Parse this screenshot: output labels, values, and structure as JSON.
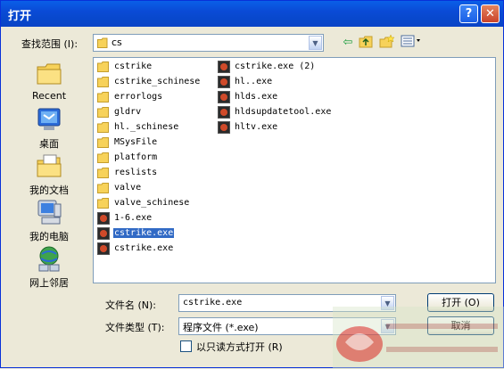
{
  "window": {
    "title": "打开",
    "help_glyph": "?",
    "close_glyph": "✕"
  },
  "lookin": {
    "label": "查找范围 (I):",
    "value": "cs"
  },
  "toolbar": {
    "icons": [
      "back-icon",
      "up-folder-icon",
      "new-folder-icon",
      "view-menu-icon"
    ]
  },
  "places": [
    {
      "label": "Recent",
      "icon": "recent-icon"
    },
    {
      "label": "桌面",
      "icon": "desktop-icon"
    },
    {
      "label": "我的文档",
      "icon": "my-documents-icon"
    },
    {
      "label": "我的电脑",
      "icon": "my-computer-icon"
    },
    {
      "label": "网上邻居",
      "icon": "network-icon"
    }
  ],
  "files_col1": [
    {
      "name": "cstrike",
      "type": "folder"
    },
    {
      "name": "cstrike_schinese",
      "type": "folder"
    },
    {
      "name": "errorlogs",
      "type": "folder"
    },
    {
      "name": "gldrv",
      "type": "folder"
    },
    {
      "name": "hl._schinese",
      "type": "folder"
    },
    {
      "name": "MSysFile",
      "type": "folder"
    },
    {
      "name": "platform",
      "type": "folder"
    },
    {
      "name": "reslists",
      "type": "folder"
    },
    {
      "name": "valve",
      "type": "folder"
    },
    {
      "name": "valve_schinese",
      "type": "folder"
    },
    {
      "name": "1-6.exe",
      "type": "exe"
    },
    {
      "name": "cstrike.exe",
      "type": "exe",
      "selected": true
    },
    {
      "name": "cstrike.exe",
      "type": "exe"
    }
  ],
  "files_col2": [
    {
      "name": "cstrike.exe (2)",
      "type": "exe"
    },
    {
      "name": "hl..exe",
      "type": "exe"
    },
    {
      "name": "hlds.exe",
      "type": "exe"
    },
    {
      "name": "hldsupdatetool.exe",
      "type": "exe"
    },
    {
      "name": "hltv.exe",
      "type": "exe"
    }
  ],
  "filename": {
    "label": "文件名 (N):",
    "value": "cstrike.exe"
  },
  "filetype": {
    "label": "文件类型 (T):",
    "value": "程序文件 (*.exe)"
  },
  "readonly": {
    "label": "以只读方式打开 (R)"
  },
  "buttons": {
    "open": "打开 (O)",
    "cancel": "取消"
  },
  "colors": {
    "title_bar": "#0a4bd6",
    "selection": "#316ac5",
    "dialog_bg": "#ece9d8"
  }
}
